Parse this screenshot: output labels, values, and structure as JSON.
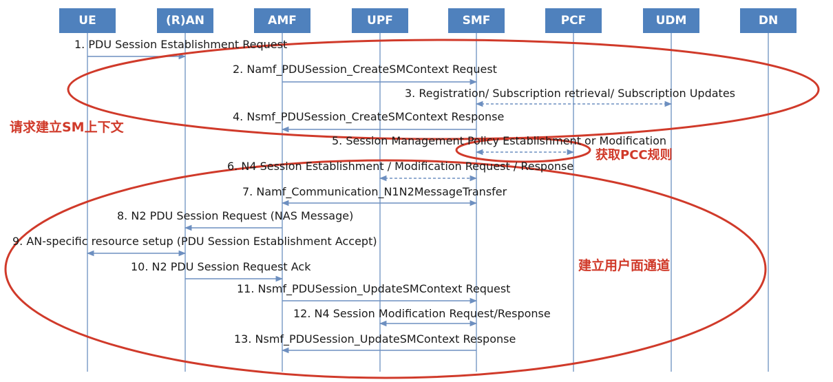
{
  "nodes": [
    "UE",
    "(R)AN",
    "AMF",
    "UPF",
    "SMF",
    "PCF",
    "UDM",
    "DN"
  ],
  "messages": [
    "1. PDU Session Establishment Request",
    "2. Namf_PDUSession_CreateSMContext Request",
    "3. Registration/ Subscription retrieval/ Subscription Updates",
    "4. Nsmf_PDUSession_CreateSMContext Response",
    "5. Session Management Policy Establishment or Modification",
    "6. N4 Session Establishment / Modification Request / Response",
    "7. Namf_Communication_N1N2MessageTransfer",
    "8. N2 PDU Session Request (NAS Message)",
    "9. AN-specific resource setup (PDU Session Establishment Accept)",
    "10. N2 PDU Session Request Ack",
    "11. Nsmf_PDUSession_UpdateSMContext Request",
    "12. N4 Session Modification Request/Response",
    "13. Nsmf_PDUSession_UpdateSMContext Response"
  ],
  "annotations": [
    "请求建立SM上下文",
    "获取PCC规则",
    "建立用户面通道"
  ],
  "colors": {
    "node_fill": "#4f81bd",
    "node_text": "#ffffff",
    "lifeline": "#9fb7d6",
    "arrow": "#6d8fc0",
    "annotation": "#d03a2a"
  }
}
